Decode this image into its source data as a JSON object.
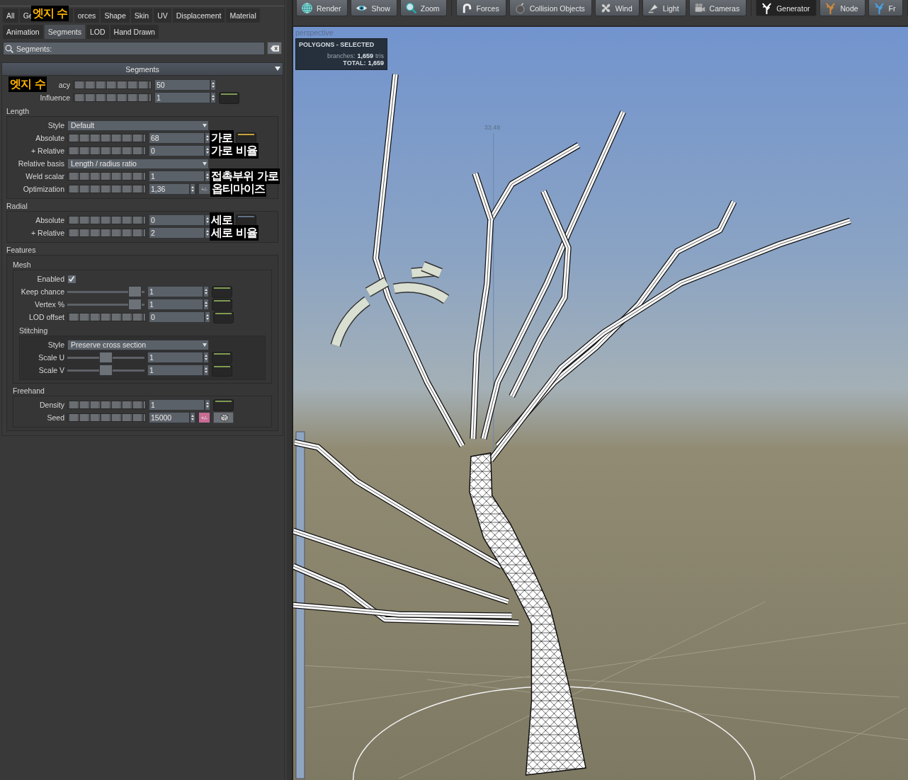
{
  "tab_rows": [
    {
      "tabs": [
        {
          "label": "All",
          "selected": false
        },
        {
          "label": "Ge",
          "selected": false,
          "note": {
            "text": "엣지 수",
            "highlighted": true
          }
        },
        {
          "label": "orces",
          "selected": false
        },
        {
          "label": "Shape",
          "selected": false
        },
        {
          "label": "Skin",
          "selected": false
        },
        {
          "label": "UV",
          "selected": false
        },
        {
          "label": "Displacement",
          "selected": false
        },
        {
          "label": "Material",
          "selected": false
        }
      ]
    },
    {
      "tabs": [
        {
          "label": "Animation",
          "selected": false
        },
        {
          "label": "Segments",
          "selected": true
        },
        {
          "label": "LOD",
          "selected": false
        },
        {
          "label": "Hand Drawn",
          "selected": false
        }
      ]
    }
  ],
  "search": {
    "value": "Segments:"
  },
  "section": {
    "title": "Segments",
    "expanded": true,
    "rows": [
      {
        "kind": "ribbed",
        "label": "acy",
        "value": "50",
        "note": {
          "text": "엣지 수",
          "highlighted": true,
          "kind": "label"
        }
      },
      {
        "kind": "ribbed",
        "label": "Influence",
        "value": "1",
        "color": "#7f9a52"
      }
    ],
    "groups": [
      {
        "title": "Length",
        "rows": [
          {
            "kind": "dropdown",
            "label": "Style",
            "value": "Default"
          },
          {
            "kind": "ribbed",
            "label": "Absolute",
            "value": "68",
            "color": "#c9a33a",
            "note": {
              "text": "가로",
              "highlighted": false,
              "kind": "after"
            }
          },
          {
            "kind": "ribbed",
            "label": "+ Relative",
            "value": "0",
            "note": {
              "text": "가로 비율",
              "highlighted": false,
              "kind": "after"
            }
          },
          {
            "kind": "dropdown",
            "label": "Relative basis",
            "value": "Length / radius ratio"
          },
          {
            "kind": "ribbed",
            "label": "Weld scalar",
            "value": "1",
            "note": {
              "text": "접촉부위 가로",
              "highlighted": false,
              "kind": "after"
            }
          },
          {
            "kind": "ribbed",
            "label": "Optimization",
            "value": "1,36",
            "buttons": [
              {
                "kind": "toggle",
                "label": "+/-",
                "on": false
              }
            ],
            "note": {
              "text": "옵티마이즈",
              "highlighted": false,
              "kind": "after"
            }
          }
        ]
      },
      {
        "title": "Radial",
        "rows": [
          {
            "kind": "ribbed",
            "label": "Absolute",
            "value": "0",
            "color": "#5f7284",
            "note": {
              "text": "세로",
              "highlighted": false,
              "kind": "after"
            }
          },
          {
            "kind": "ribbed",
            "label": "+ Relative",
            "value": "2",
            "note": {
              "text": "세로 비율",
              "highlighted": false,
              "kind": "after"
            }
          }
        ]
      },
      {
        "title": "Features",
        "groups": [
          {
            "title": "Mesh",
            "rows": [
              {
                "kind": "checkbox",
                "label": "Enabled",
                "checked": true
              },
              {
                "kind": "thumb",
                "label": "Keep chance",
                "value": "1",
                "level": 0.95,
                "color": "#7f9a52"
              },
              {
                "kind": "thumb",
                "label": "Vertex %",
                "value": "1",
                "level": 0.95,
                "color": "#7f9a52"
              },
              {
                "kind": "ribbed",
                "label": "LOD offset",
                "value": "0",
                "color": "#7f9a52"
              }
            ],
            "groups": [
              {
                "title": "Stitching",
                "rows": [
                  {
                    "kind": "dropdown",
                    "label": "Style",
                    "value": "Preserve cross section"
                  },
                  {
                    "kind": "thumb",
                    "label": "Scale U",
                    "value": "1",
                    "level": 0.5,
                    "color": "#7f9a52"
                  },
                  {
                    "kind": "thumb",
                    "label": "Scale V",
                    "value": "1",
                    "level": 0.5,
                    "color": "#7f9a52"
                  }
                ]
              }
            ]
          },
          {
            "title": "Freehand",
            "rows": [
              {
                "kind": "ribbed",
                "label": "Density",
                "value": "1",
                "color": "#7f9a52"
              },
              {
                "kind": "ribbed",
                "label": "Seed",
                "value": "15000",
                "buttons": [
                  {
                    "kind": "toggle",
                    "label": "+/-",
                    "on": true
                  },
                  {
                    "kind": "dice"
                  }
                ]
              }
            ]
          }
        ]
      }
    ]
  },
  "toolbar": {
    "groups": [
      {
        "buttons": [
          {
            "label": "Render",
            "kind": "globe",
            "selected": false
          },
          {
            "label": "Show",
            "kind": "eye",
            "selected": false
          },
          {
            "label": "Zoom",
            "kind": "magnifier",
            "selected": false
          }
        ]
      },
      {
        "buttons": [
          {
            "label": "Forces",
            "kind": "magnet",
            "selected": false
          },
          {
            "label": "Collision Objects",
            "kind": "bomb",
            "selected": false
          },
          {
            "label": "Wind",
            "kind": "fan",
            "selected": false
          },
          {
            "label": "Light",
            "kind": "lamp",
            "selected": false
          },
          {
            "label": "Cameras",
            "kind": "camera",
            "selected": false
          }
        ]
      },
      {
        "buttons": [
          {
            "label": "Generator",
            "kind": "tree",
            "color": "#ffffff",
            "selected": true
          },
          {
            "label": "Node",
            "kind": "tree",
            "color": "#d08a3a",
            "selected": false
          },
          {
            "label": "Fr",
            "kind": "tree",
            "color": "#4aa0e0",
            "selected": false
          }
        ]
      }
    ]
  },
  "viewport": {
    "camera": "perspective",
    "stats": {
      "title": "POLYGONS - SELECTED",
      "lines": [
        {
          "label": "branches:",
          "value": "1,659",
          "unit": "tris"
        },
        {
          "label": "TOTAL:",
          "value": "1,659"
        }
      ]
    },
    "measure": "33.48"
  }
}
